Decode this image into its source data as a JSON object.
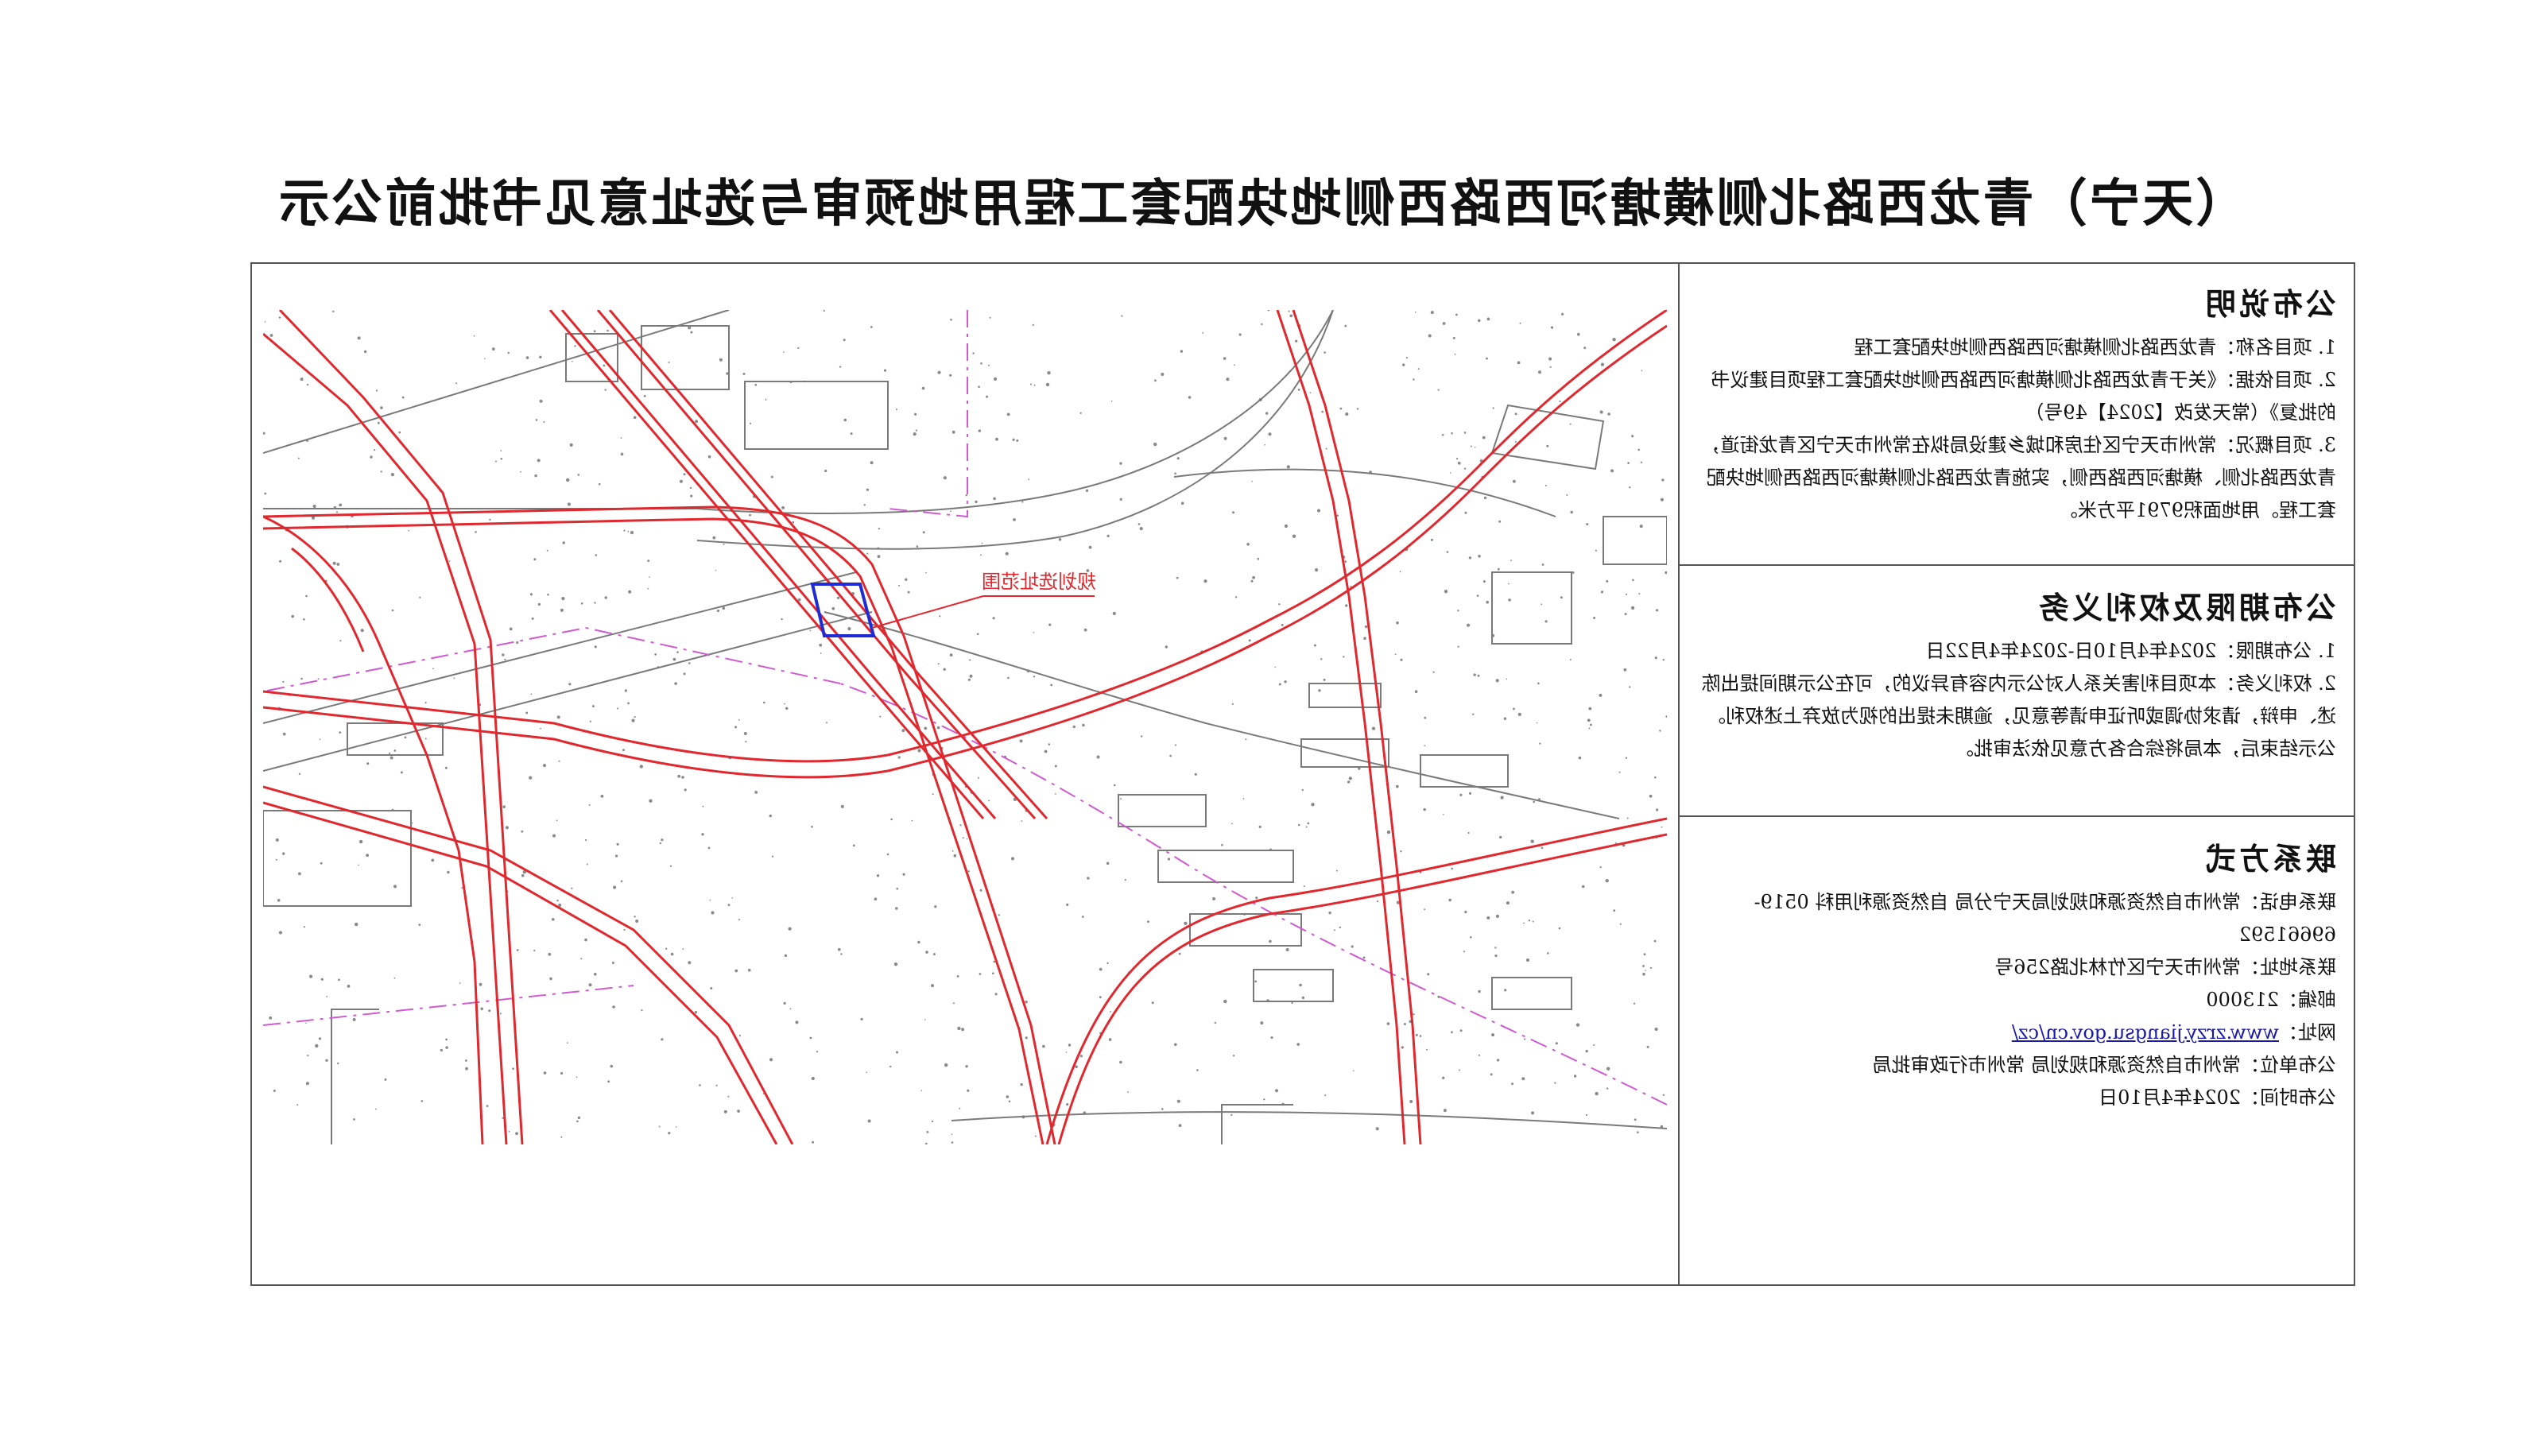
{
  "title": "（天宁）青龙西路北侧横塘河西路西侧地块配套工程用地预审与选址意见书批前公示",
  "sections": {
    "announcement": {
      "heading": "公布说明",
      "items": [
        "1. 项目名称：青龙西路北侧横塘河西路西侧地块配套工程",
        "2. 项目依据：《关于青龙西路北侧横塘河西路西侧地块配套工程项目建议书的批复》（常天发改【2024】49号）",
        "3. 项目概况：常州市天宁区住房和城乡建设局拟在常州市天宁区青龙街道，青龙西路北侧、横塘河西路西侧，实施青龙西路北侧横塘河西路西侧地块配套工程。用地面积9791平方米。"
      ]
    },
    "rights": {
      "heading": "公布期限及权利义务",
      "items": [
        "1. 公布期限：2024年4月10日-2024年4月22日",
        "2. 权利义务：本项目利害关系人对公示内容有异议的，可在公示期间提出陈述、申辩，请求协调或听证申请等意见，逾期未提出的视为放弃上述权利。公示结束后，本局将综合各方意见依法审批。"
      ]
    },
    "contact": {
      "heading": "联系方式",
      "phone": "联系电话：常州市自然资源和规划局天宁分局 自然资源利用科 0519-69661592",
      "address": "联系地址：常州市天宁区竹林北路256号",
      "postcode": "邮编：213000",
      "website_label": "网址：",
      "website": "www.zrzy.jiangsu.gov.cn/cz/",
      "publisher": "公布单位：常州市自然资源和规划局 常州市行政审批局",
      "date": "公布时间：2024年4月10日"
    }
  },
  "map": {
    "label": "规划选址范围",
    "colors": {
      "road": "#e0282e",
      "boundary": "#d05ad0",
      "site": "#1f2bd4",
      "base": "#777777"
    }
  }
}
